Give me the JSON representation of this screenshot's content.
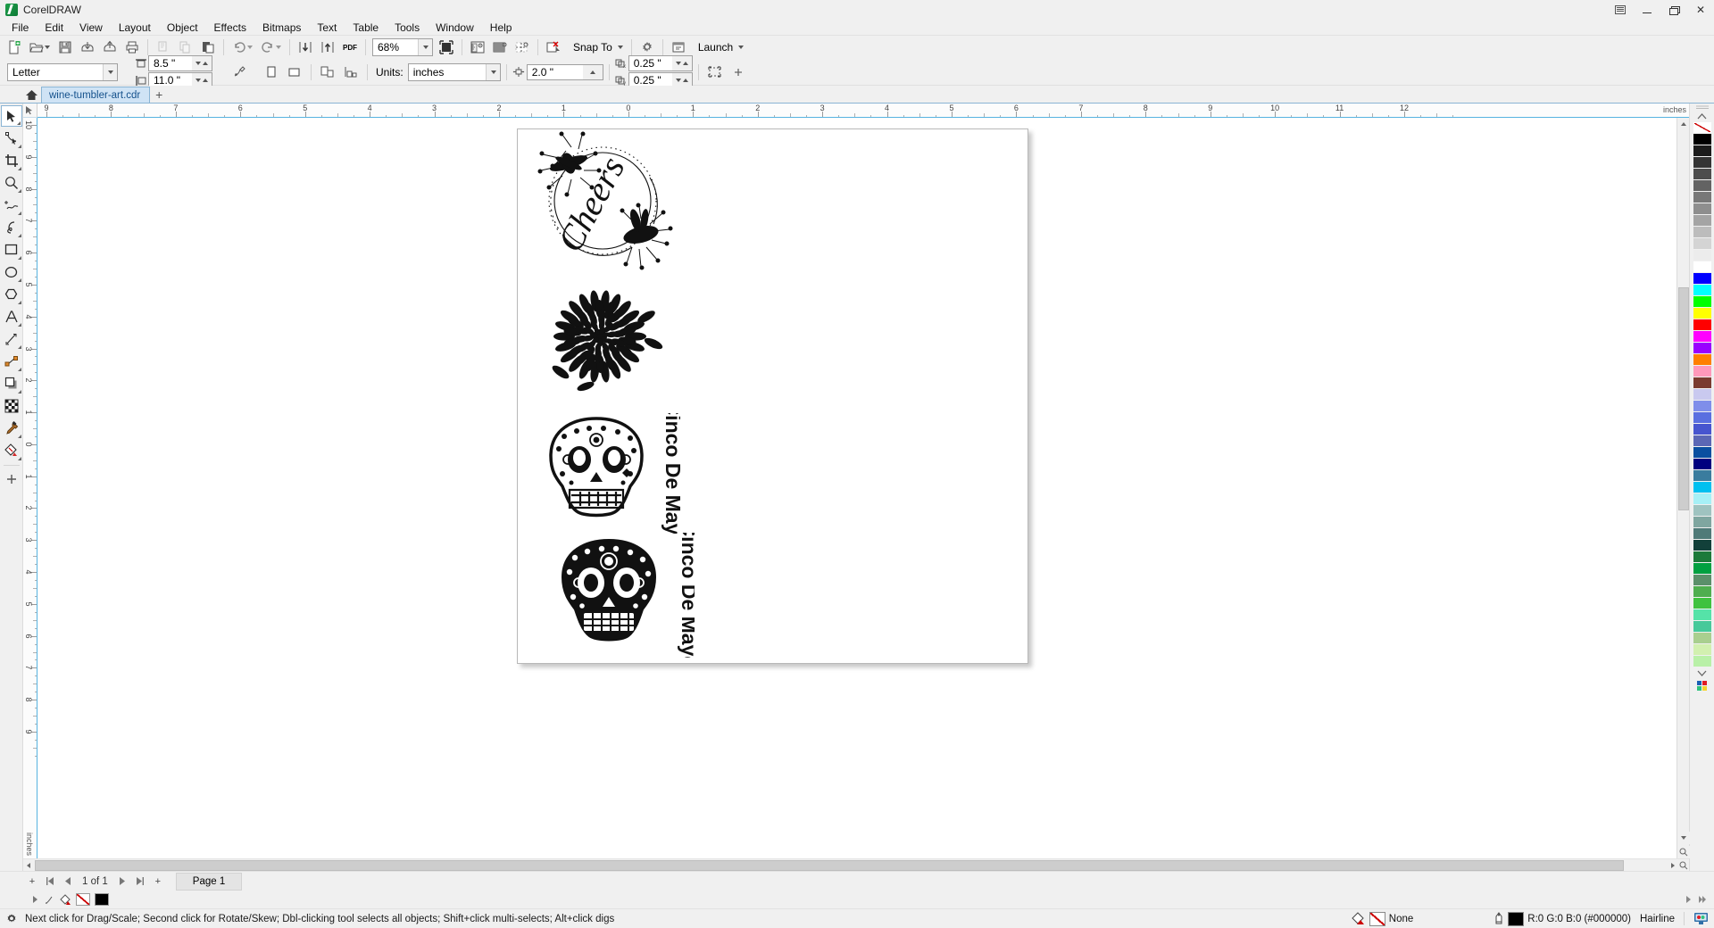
{
  "window": {
    "app_title": "CorelDRAW",
    "logo_icon": "coreldraw-balloon-icon",
    "controls": {
      "doc_tabs_icon": "document-tabs-icon",
      "minimize": "minimize-icon",
      "restore": "restore-icon",
      "close": "close-icon",
      "close_glyph": "✕"
    }
  },
  "menu": {
    "items": [
      {
        "label": "File"
      },
      {
        "label": "Edit"
      },
      {
        "label": "View"
      },
      {
        "label": "Layout"
      },
      {
        "label": "Object"
      },
      {
        "label": "Effects"
      },
      {
        "label": "Bitmaps"
      },
      {
        "label": "Text"
      },
      {
        "label": "Table"
      },
      {
        "label": "Tools"
      },
      {
        "label": "Window"
      },
      {
        "label": "Help"
      }
    ]
  },
  "toolbar": {
    "new_label": "new-document",
    "open_label": "open-document",
    "save_label": "save-document",
    "import_label": "import",
    "export_label": "export",
    "print_label": "print",
    "cut_label": "cut",
    "copy_label": "copy",
    "paste_label": "paste",
    "undo_label": "undo",
    "redo_label": "redo",
    "publish_pdf_label": "PDF",
    "zoom_value": "68%",
    "snap_to_label": "Snap To",
    "launch_label": "Launch",
    "options_label": "options",
    "import_icon_label": "import-icon",
    "export_icon_label": "export-icon"
  },
  "propbar": {
    "page_size": "Letter",
    "page_width": "8.5 \"",
    "page_height": "11.0 \"",
    "units_label": "Units:",
    "units_value": "inches",
    "nudge_value": "2.0 \"",
    "duplicate_x": "0.25 \"",
    "duplicate_y": "0.25 \""
  },
  "tabs": {
    "home_icon": "home-icon",
    "documents": [
      {
        "label": "wine-tumbler-art.cdr",
        "active": true
      }
    ],
    "add_label": "+"
  },
  "toolbox": {
    "tools": [
      {
        "name": "pick-tool",
        "active": true,
        "flyout": true
      },
      {
        "name": "shape-tool",
        "active": false,
        "flyout": true
      },
      {
        "name": "crop-tool",
        "active": false,
        "flyout": true
      },
      {
        "name": "zoom-tool",
        "active": false,
        "flyout": true
      },
      {
        "name": "freehand-tool",
        "active": false,
        "flyout": true
      },
      {
        "name": "artistic-media-tool",
        "active": false,
        "flyout": true
      },
      {
        "name": "rectangle-tool",
        "active": false,
        "flyout": true
      },
      {
        "name": "ellipse-tool",
        "active": false,
        "flyout": true
      },
      {
        "name": "polygon-tool",
        "active": false,
        "flyout": true
      },
      {
        "name": "text-tool",
        "active": false,
        "flyout": true
      },
      {
        "name": "dimension-tool",
        "active": false,
        "flyout": true
      },
      {
        "name": "connector-tool",
        "active": false,
        "flyout": true
      },
      {
        "name": "drop-shadow-tool",
        "active": false,
        "flyout": true
      },
      {
        "name": "transparency-tool",
        "active": false,
        "flyout": false
      },
      {
        "name": "color-eyedropper-tool",
        "active": false,
        "flyout": true
      },
      {
        "name": "interactive-fill-tool",
        "active": false,
        "flyout": true
      },
      {
        "name": "quick-customize-button",
        "active": false,
        "flyout": false
      }
    ]
  },
  "rulers": {
    "units": "inches",
    "horizontal_labels": [
      9,
      8,
      7,
      6,
      5,
      4,
      3,
      2,
      1,
      0,
      1,
      2,
      3,
      4,
      5,
      6,
      7,
      8,
      9,
      10,
      11,
      12
    ],
    "vertical_labels": [
      10,
      9,
      8,
      7,
      6,
      5,
      4,
      3,
      2,
      1,
      0,
      1,
      2,
      3,
      4,
      5,
      6,
      7,
      8,
      9
    ]
  },
  "artwork": {
    "title": "wine tumbler art",
    "items": [
      {
        "name": "cheers-floral-wreath",
        "text": "Cheers"
      },
      {
        "name": "dahlia-flower",
        "text": ""
      },
      {
        "name": "sugar-skull-outline",
        "text": "Cinco De Mayo"
      },
      {
        "name": "sugar-skull-filled",
        "text": "Cinco De Mayo"
      }
    ]
  },
  "pagenav": {
    "add_page_left": "+",
    "first": "◀|",
    "prev": "◀",
    "counter": "1 of 1",
    "next": "▶",
    "last": "|▶",
    "add_page_right": "+",
    "page_tab": "Page 1"
  },
  "statusbar": {
    "hint": "Next click for Drag/Scale; Second click for Rotate/Skew; Dbl-clicking tool selects all objects; Shift+click multi-selects; Alt+click digs",
    "fill_icon": "fill-color-icon",
    "fill_value": "None",
    "outline_icon": "outline-pen-icon",
    "outline_value": "R:0 G:0 B:0 (#000000)",
    "outline_width": "Hairline",
    "color_proof_icon": "color-proof-icon",
    "gear_icon": "gear-icon"
  },
  "colors": {
    "accent": "#57b3e0",
    "tab_active_bg": "#cfe3f5",
    "tab_active_text": "#14518c",
    "chrome_bg": "#f0f0f0",
    "canvas_bg": "#ffffff",
    "outline_black": "#000000"
  },
  "palette": {
    "swatches": [
      "none",
      "#000000",
      "#1c1c1c",
      "#343434",
      "#4d4d4d",
      "#636363",
      "#787878",
      "#8e8e8e",
      "#a4a4a4",
      "#bcbcbc",
      "#d4d4d4",
      "#ececec",
      "#ffffff",
      "#0000ff",
      "#00ffff",
      "#00ff00",
      "#ffff00",
      "#ff0000",
      "#ff00ff",
      "#9900ff",
      "#ff7f00",
      "#ff99bb",
      "#7a3b30",
      "#c9c9ef",
      "#7f8eea",
      "#5a6fe0",
      "#4755cf",
      "#5b67b5",
      "#0a4fa0",
      "#00007f",
      "#3a7c9e",
      "#00c0f0",
      "#a6f0f6",
      "#9fc3c0",
      "#7fa6a0",
      "#4f7a78",
      "#12403a",
      "#1c7a3a",
      "#00a040",
      "#5b8f6a",
      "#4fae4f",
      "#3fc23f",
      "#55e3a8",
      "#46c99a",
      "#a9cf8f",
      "#d2f0b0",
      "#b9f0a8"
    ],
    "scroll_up_icon": "chevron-up-icon",
    "scroll_down_icon": "chevron-down-icon"
  }
}
